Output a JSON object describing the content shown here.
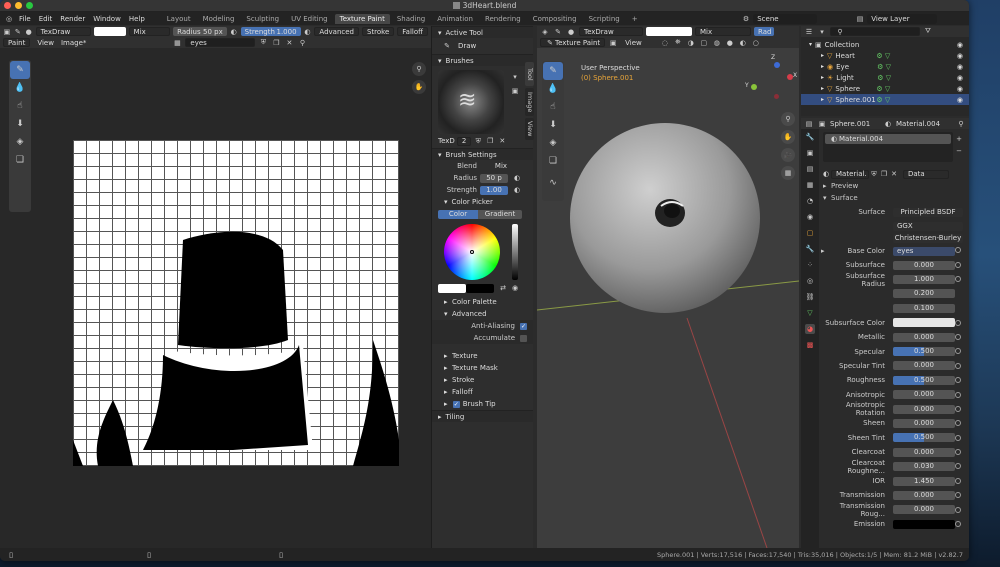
{
  "window": {
    "title": "3dHeart.blend"
  },
  "menu": [
    "File",
    "Edit",
    "Render",
    "Window",
    "Help"
  ],
  "workspaces": [
    "Layout",
    "Modeling",
    "Sculpting",
    "UV Editing",
    "Texture Paint",
    "Shading",
    "Animation",
    "Rendering",
    "Compositing",
    "Scripting"
  ],
  "active_workspace": "Texture Paint",
  "scene": "Scene",
  "view_layer": "View Layer",
  "image_editor": {
    "brush": "TexDraw",
    "blend": "Mix",
    "radius_label": "Radius",
    "radius_value": "50 px",
    "strength_label": "Strength",
    "strength_value": "1.000",
    "advanced": "Advanced",
    "stroke": "Stroke",
    "falloff": "Falloff",
    "mode": "Paint",
    "view": "View",
    "image_menu": "Image*",
    "image_name": "eyes"
  },
  "sidebar": {
    "tabs": [
      "Tool",
      "Image",
      "View"
    ],
    "active_tool_title": "Active Tool",
    "active_tool": "Draw",
    "brushes_title": "Brushes",
    "brush_name": "TexD",
    "brush_users": "2",
    "brush_settings": "Brush Settings",
    "blend_label": "Blend",
    "blend_value": "Mix",
    "radius_label": "Radius",
    "radius_value": "50 p",
    "strength_label": "Strength",
    "strength_value": "1.00",
    "color_picker": "Color Picker",
    "color_tab": "Color",
    "gradient_tab": "Gradient",
    "color_palette": "Color Palette",
    "advanced": "Advanced",
    "anti_aliasing": "Anti-Aliasing",
    "accumulate": "Accumulate",
    "texture": "Texture",
    "texture_mask": "Texture Mask",
    "stroke": "Stroke",
    "falloff": "Falloff",
    "brush_tip": "Brush Tip",
    "tiling": "Tiling"
  },
  "viewport": {
    "brush": "TexDraw",
    "blend": "Mix",
    "radius_short": "Rad",
    "mode": "Texture Paint",
    "view": "View",
    "perspective": "User Perspective",
    "object": "(0) Sphere.001",
    "axes": {
      "x": "X",
      "y": "Y",
      "z": "Z"
    }
  },
  "outliner": {
    "search_placeholder": "",
    "items": [
      {
        "name": "Collection",
        "level": 0,
        "selected": false
      },
      {
        "name": "Heart",
        "level": 1,
        "selected": false
      },
      {
        "name": "Eye",
        "level": 1,
        "selected": false
      },
      {
        "name": "Light",
        "level": 1,
        "selected": false
      },
      {
        "name": "Sphere",
        "level": 1,
        "selected": false
      },
      {
        "name": "Sphere.001",
        "level": 1,
        "selected": true
      }
    ]
  },
  "properties": {
    "object": "Sphere.001",
    "material": "Material.004",
    "slot": "Material.004",
    "mat_field": "Material.",
    "data": "Data",
    "preview": "Preview",
    "surface_section": "Surface",
    "surface_label": "Surface",
    "surface_value": "Principled BSDF",
    "distribution": "GGX",
    "subsurface_method": "Christensen-Burley",
    "base_color_label": "Base Color",
    "base_color_value": "eyes",
    "fields": [
      {
        "label": "Subsurface",
        "value": "0.000"
      },
      {
        "label": "Subsurface Radius",
        "value": "1.000"
      },
      {
        "label": "",
        "value": "0.200"
      },
      {
        "label": "",
        "value": "0.100"
      },
      {
        "label": "Subsurface Color",
        "value": ""
      },
      {
        "label": "Metallic",
        "value": "0.000"
      },
      {
        "label": "Specular",
        "value": "0.500",
        "bar": 0.5
      },
      {
        "label": "Specular Tint",
        "value": "0.000"
      },
      {
        "label": "Roughness",
        "value": "0.500",
        "bar": 0.5
      },
      {
        "label": "Anisotropic",
        "value": "0.000"
      },
      {
        "label": "Anisotropic Rotation",
        "value": "0.000"
      },
      {
        "label": "Sheen",
        "value": "0.000"
      },
      {
        "label": "Sheen Tint",
        "value": "0.500",
        "bar": 0.5
      },
      {
        "label": "Clearcoat",
        "value": "0.000"
      },
      {
        "label": "Clearcoat Roughne...",
        "value": "0.030"
      },
      {
        "label": "IOR",
        "value": "1.450"
      },
      {
        "label": "Transmission",
        "value": "0.000"
      },
      {
        "label": "Transmission Roug...",
        "value": "0.000"
      },
      {
        "label": "Emission",
        "value": ""
      }
    ]
  },
  "status": {
    "text": "Sphere.001 | Verts:17,516 | Faces:17,540 | Tris:35,016 | Objects:1/5 | Mem: 81.2 MiB | v2.82.7"
  },
  "colors": {
    "accent": "#4772b3",
    "mac_red": "#ff5f57",
    "mac_yellow": "#febc2e",
    "mac_green": "#28c840"
  }
}
